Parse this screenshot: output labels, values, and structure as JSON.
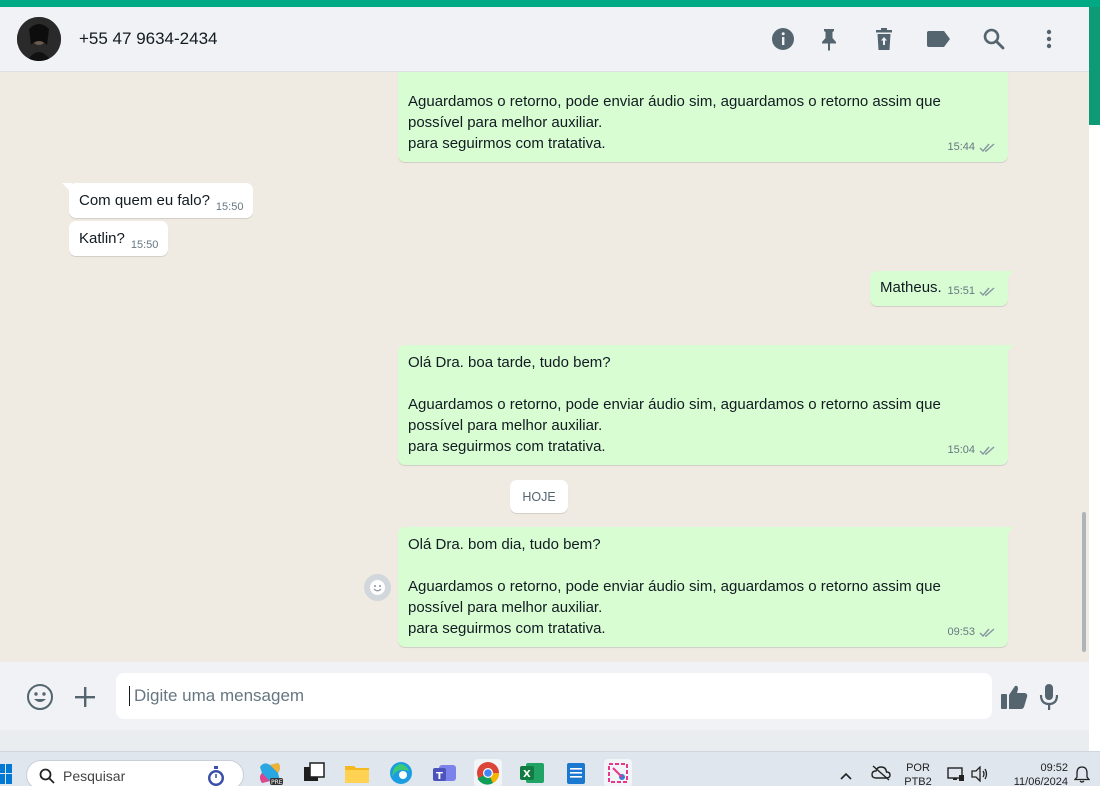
{
  "header": {
    "contact_name": "+55 47 9634-2434",
    "icons": [
      "info-icon",
      "pin-icon",
      "delete-icon",
      "label-icon",
      "search-icon",
      "menu-icon"
    ]
  },
  "messages": [
    {
      "dir": "out",
      "text": "Aguardamos o retorno, pode enviar áudio sim, aguardamos o retorno assim que\npossível para melhor auxiliar.\npara seguirmos com tratativa.",
      "time": "15:44",
      "status": "read"
    },
    {
      "dir": "in",
      "text": "Com quem eu falo?",
      "time": "15:50"
    },
    {
      "dir": "in",
      "text": "Katlin?",
      "time": "15:50"
    },
    {
      "dir": "out",
      "text": "Matheus.",
      "time": "15:51",
      "status": "read"
    },
    {
      "dir": "out",
      "text": "Olá Dra. boa tarde, tudo bem?\n\nAguardamos o retorno, pode enviar áudio sim, aguardamos o retorno assim que\npossível para melhor auxiliar.\npara seguirmos com tratativa.",
      "time": "15:04",
      "status": "read"
    },
    {
      "dir": "out",
      "text": "Olá Dra. bom dia, tudo bem?\n\nAguardamos o retorno, pode enviar áudio sim, aguardamos o retorno assim que\npossível para melhor auxiliar.\npara seguirmos com tratativa.",
      "time": "09:53",
      "status": "read"
    }
  ],
  "date_divider": "HOJE",
  "composer": {
    "placeholder": "Digite uma mensagem"
  },
  "taskbar": {
    "search_label": "Pesquisar",
    "lang_line1": "POR",
    "lang_line2": "PTB2",
    "time": "09:52",
    "date": "11/06/2024"
  },
  "colors": {
    "accent": "#00a884",
    "outgoing_bubble": "#d9fdd3",
    "incoming_bubble": "#ffffff",
    "chat_bg": "#efeae2",
    "read_ticks": "#8696a0"
  }
}
